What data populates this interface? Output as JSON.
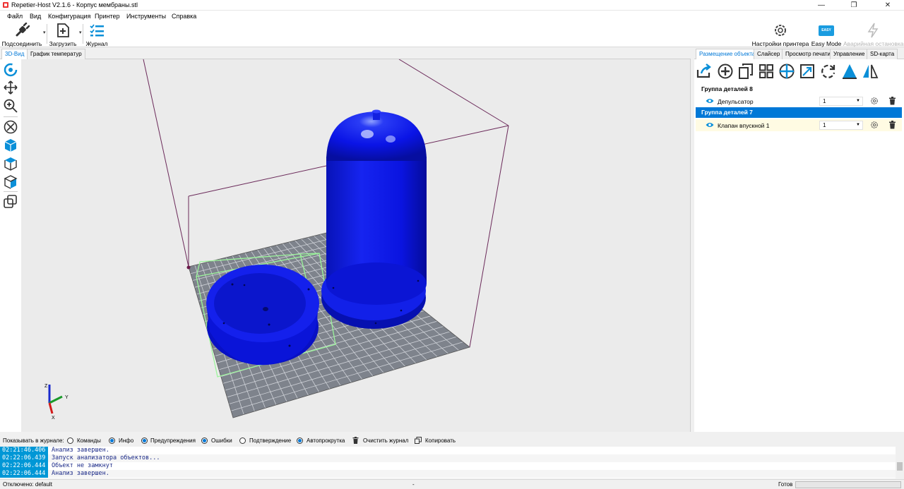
{
  "window": {
    "title": "Repetier-Host V2.1.6 - Корпус мембраны.stl",
    "minimize": "—",
    "restore": "❐",
    "close": "✕"
  },
  "menu": [
    "Файл",
    "Вид",
    "Конфигурация",
    "Принтер",
    "Инструменты",
    "Справка"
  ],
  "toolbar": {
    "connect": "Подсоединить",
    "load": "Загрузить",
    "log": "Журнал",
    "printer_settings": "Настройки принтера",
    "easy_mode": "Easy Mode",
    "easy_badge": "EASY",
    "emergency_stop": "Аварийная остановка",
    "dropdown_arrow": "▾"
  },
  "left_tabs": [
    "3D-Вид",
    "График температур"
  ],
  "right_tabs": [
    "Размещение объекта",
    "Слайсер",
    "Просмотр печати",
    "Управление",
    "SD-карта"
  ],
  "object_panel": {
    "groups": [
      {
        "title": "Группа деталей 8",
        "selected": false,
        "items": [
          {
            "name": "Депульсатор",
            "qty": "1",
            "selected": false
          }
        ]
      },
      {
        "title": "Группа деталей 7",
        "selected": true,
        "items": [
          {
            "name": "Клапан впускной 1",
            "qty": "1",
            "selected": true
          }
        ]
      }
    ]
  },
  "axis": {
    "x": "X",
    "y": "Y",
    "z": "Z"
  },
  "log_filters": {
    "label": "Показывать в журнале:",
    "commands": "Команды",
    "info": "Инфо",
    "warnings": "Предупреждения",
    "errors": "Ошибки",
    "acknowledgements": "Подтверждение",
    "autoscroll": "Автопрокрутка",
    "clear": "Очистить журнал",
    "copy": "Копировать"
  },
  "log_entries": [
    {
      "time": "02:21:46.406",
      "message": "Анализ завершен."
    },
    {
      "time": "02:22:06.439",
      "message": "Запуск анализатора объектов..."
    },
    {
      "time": "02:22:06.444",
      "message": "Объект не замкнут"
    },
    {
      "time": "02:22:06.444",
      "message": "Анализ завершен."
    }
  ],
  "status": {
    "connection": "Отключено: default",
    "middle": "-",
    "state": "Готов"
  },
  "colors": {
    "accent": "#0078d7",
    "model": "#0a14e6",
    "grid": "#7e838c",
    "build_volume": "#6b2a5a",
    "selection_box": "#9cf59c"
  }
}
